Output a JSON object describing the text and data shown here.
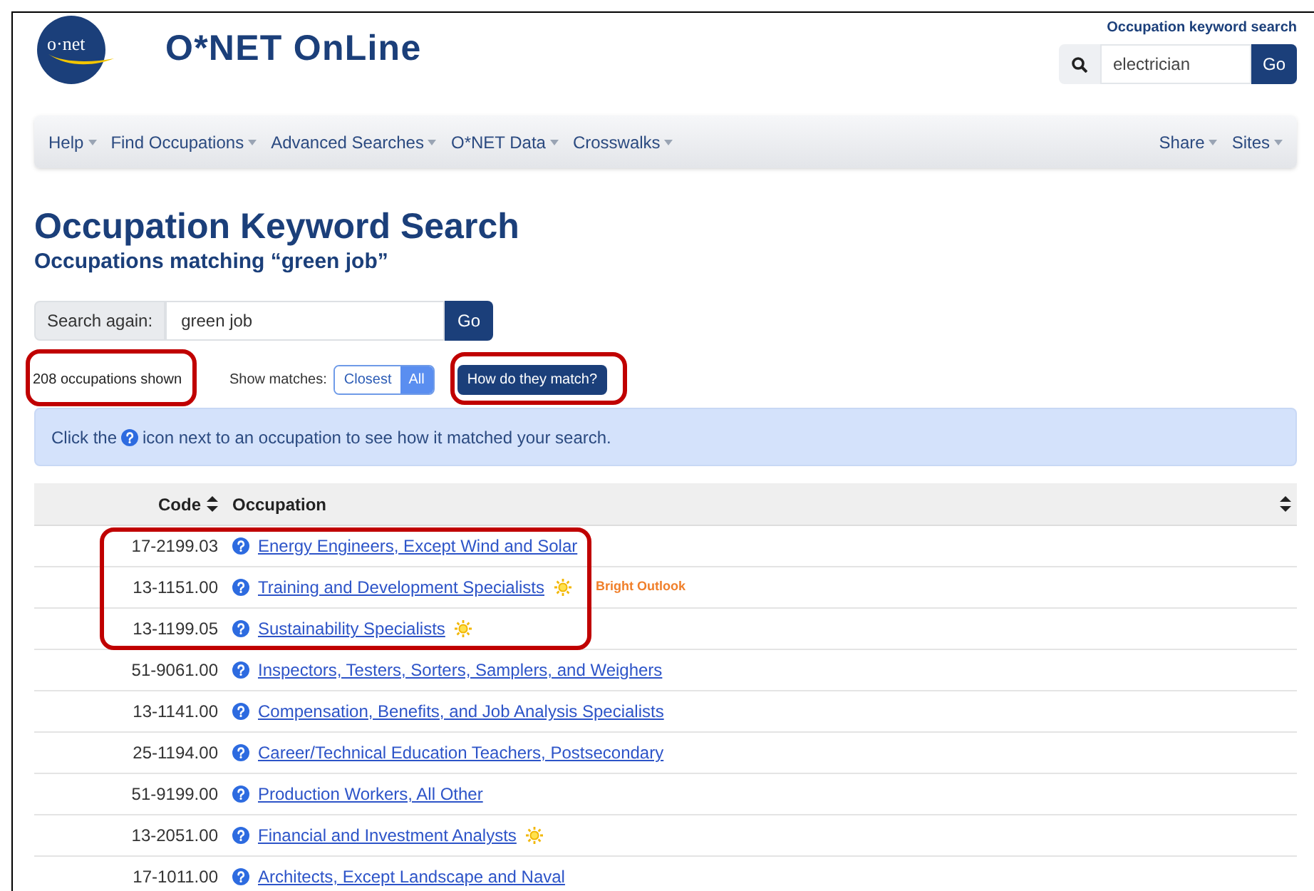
{
  "header": {
    "logo_text": "o·net",
    "site_title": "O*NET OnLine",
    "quick_search": {
      "label": "Occupation keyword search",
      "value": "electrician",
      "button": "Go"
    }
  },
  "nav": {
    "left": [
      {
        "label": "Help"
      },
      {
        "label": "Find Occupations"
      },
      {
        "label": "Advanced Searches"
      },
      {
        "label": "O*NET Data"
      },
      {
        "label": "Crosswalks"
      }
    ],
    "right": [
      {
        "label": "Share"
      },
      {
        "label": "Sites"
      }
    ]
  },
  "page": {
    "title": "Occupation Keyword Search",
    "subtitle": "Occupations matching “green job”"
  },
  "search_again": {
    "label": "Search again:",
    "value": "green job",
    "button": "Go"
  },
  "results_count": "208 occupations shown",
  "show_matches": {
    "label": "Show matches:",
    "options": [
      {
        "label": "Closest",
        "selected": false
      },
      {
        "label": "All",
        "selected": true
      }
    ]
  },
  "how_button": "How do they match?",
  "info": {
    "before": "Click the",
    "after": "icon next to an occupation to see how it matched your search."
  },
  "table": {
    "columns": [
      "Code",
      "Occupation"
    ],
    "rows": [
      {
        "code": "17-2199.03",
        "title": "Energy Engineers, Except Wind and Solar",
        "bright_outlook": false
      },
      {
        "code": "13-1151.00",
        "title": "Training and Development Specialists",
        "bright_outlook": true,
        "badge": "Bright Outlook"
      },
      {
        "code": "13-1199.05",
        "title": "Sustainability Specialists",
        "bright_outlook": true
      },
      {
        "code": "51-9061.00",
        "title": "Inspectors, Testers, Sorters, Samplers, and Weighers",
        "bright_outlook": false
      },
      {
        "code": "13-1141.00",
        "title": "Compensation, Benefits, and Job Analysis Specialists",
        "bright_outlook": false
      },
      {
        "code": "25-1194.00",
        "title": "Career/Technical Education Teachers, Postsecondary",
        "bright_outlook": false
      },
      {
        "code": "51-9199.00",
        "title": "Production Workers, All Other",
        "bright_outlook": false
      },
      {
        "code": "13-2051.00",
        "title": "Financial and Investment Analysts",
        "bright_outlook": true
      },
      {
        "code": "17-1011.00",
        "title": "Architects, Except Landscape and Naval",
        "bright_outlook": false
      }
    ]
  }
}
